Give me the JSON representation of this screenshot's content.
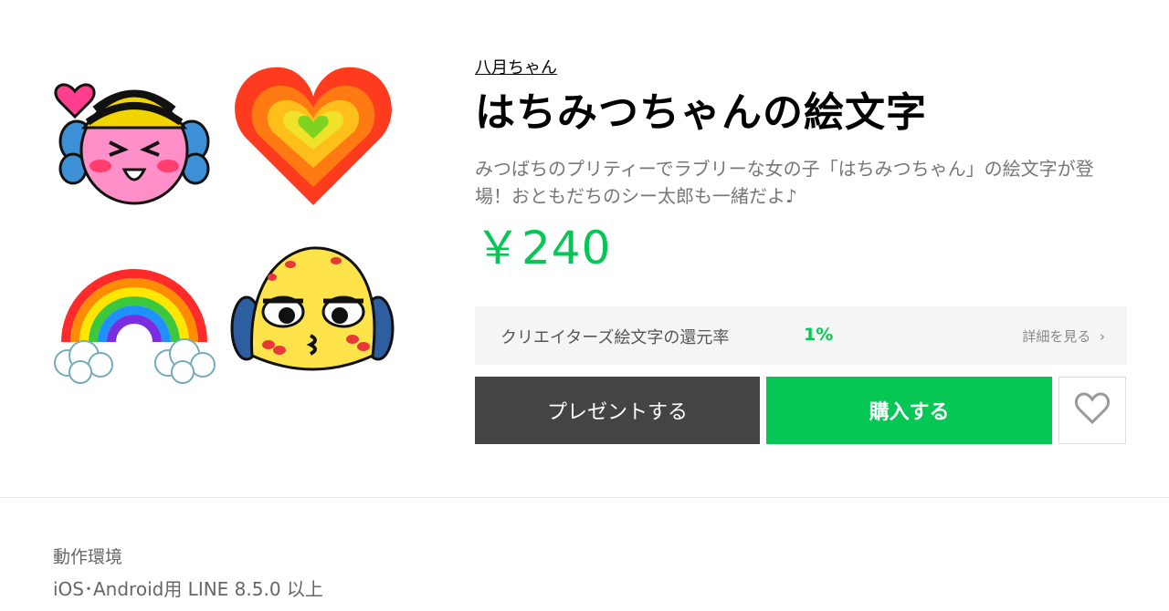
{
  "sticker": {
    "author": "八月ちゃん",
    "title": "はちみつちゃんの絵文字",
    "description": "みつばちのプリティーでラブリーな女の子「はちみつちゃん」の絵文字が登場！おともだちのシー太郎も一緒だよ♪",
    "price": "￥240"
  },
  "emoji_previews": [
    {
      "icon": "bee-girl-face-icon"
    },
    {
      "icon": "rainbow-heart-icon"
    },
    {
      "icon": "rainbow-icon"
    },
    {
      "icon": "yellow-face-kiss-icon"
    }
  ],
  "return_rate": {
    "label": "クリエイターズ絵文字の還元率",
    "value": "1%",
    "detail_link": "詳細を見る"
  },
  "buttons": {
    "present": "プレゼントする",
    "buy": "購入する",
    "favorite_icon": "heart-outline-icon"
  },
  "environment": {
    "label": "動作環境",
    "value": "iOS･Android用 LINE 8.5.0 以上"
  },
  "colors": {
    "accent": "#06c755",
    "present_button": "#444444"
  }
}
